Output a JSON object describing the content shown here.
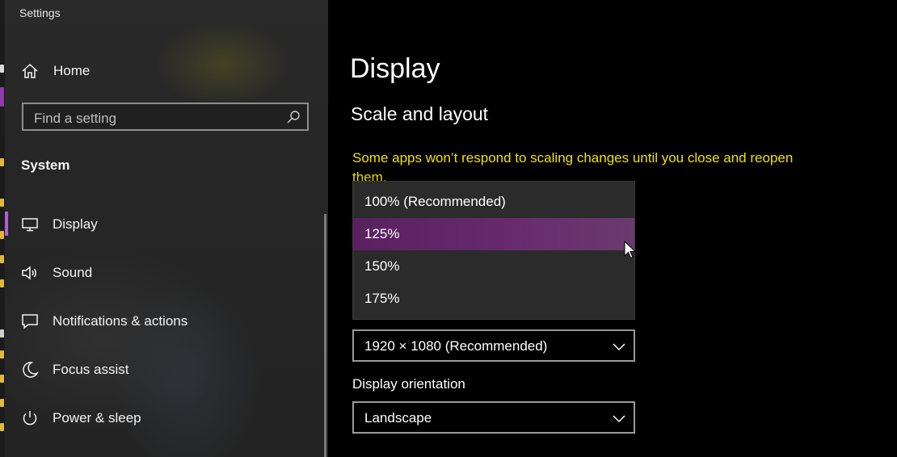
{
  "window": {
    "title": "Settings"
  },
  "sidebar": {
    "home_label": "Home",
    "search": {
      "placeholder": "Find a setting"
    },
    "section_label": "System",
    "items": [
      {
        "label": "Display",
        "icon": "monitor-icon",
        "active": true
      },
      {
        "label": "Sound",
        "icon": "speaker-icon",
        "active": false
      },
      {
        "label": "Notifications & actions",
        "icon": "notification-icon",
        "active": false
      },
      {
        "label": "Focus assist",
        "icon": "moon-icon",
        "active": false
      },
      {
        "label": "Power & sleep",
        "icon": "power-icon",
        "active": false
      }
    ]
  },
  "main": {
    "title": "Display",
    "subheading": "Scale and layout",
    "warning": "Some apps won’t respond to scaling changes until you close and reopen them.",
    "scale_dropdown": {
      "options": [
        "100% (Recommended)",
        "125%",
        "150%",
        "175%"
      ],
      "highlighted_index": 1
    },
    "resolution": {
      "value": "1920 × 1080 (Recommended)"
    },
    "orientation": {
      "label": "Display orientation",
      "value": "Landscape"
    }
  },
  "colors": {
    "accent": "#b15fd0",
    "warning_text": "#f1e100",
    "highlight": "#682c6e"
  }
}
